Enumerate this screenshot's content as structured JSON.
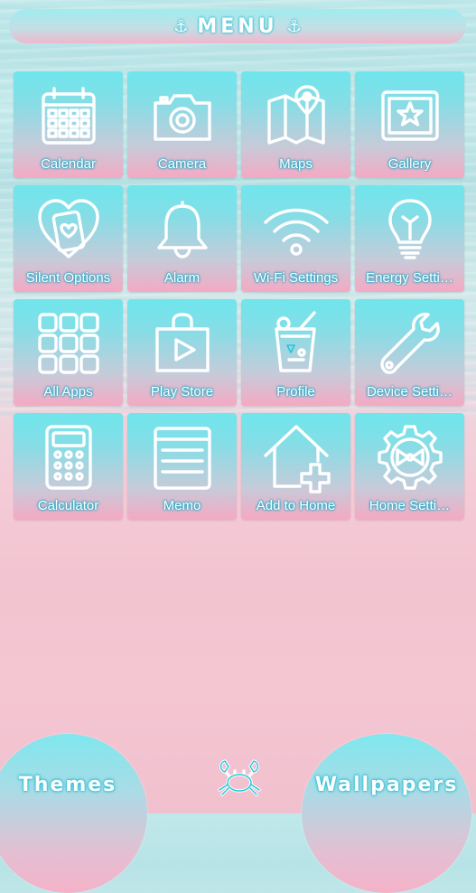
{
  "header": {
    "title": "MENU",
    "left_icon": "anchor-icon",
    "right_icon": "anchor-icon"
  },
  "apps": [
    {
      "label": "Calendar",
      "icon": "calendar-icon"
    },
    {
      "label": "Camera",
      "icon": "camera-icon"
    },
    {
      "label": "Maps",
      "icon": "map-icon"
    },
    {
      "label": "Gallery",
      "icon": "gallery-icon"
    },
    {
      "label": "Silent Options",
      "icon": "phone-heart-icon"
    },
    {
      "label": "Alarm",
      "icon": "bell-icon"
    },
    {
      "label": "Wi-Fi Settings",
      "icon": "wifi-icon"
    },
    {
      "label": "Energy Setti…",
      "icon": "lightbulb-icon"
    },
    {
      "label": "All Apps",
      "icon": "grid-icon"
    },
    {
      "label": "Play Store",
      "icon": "shopping-bag-play-icon"
    },
    {
      "label": "Profile",
      "icon": "drink-cup-icon"
    },
    {
      "label": "Device Setti…",
      "icon": "wrench-icon"
    },
    {
      "label": "Calculator",
      "icon": "calculator-icon"
    },
    {
      "label": "Memo",
      "icon": "memo-icon"
    },
    {
      "label": "Add to Home",
      "icon": "house-plus-icon"
    },
    {
      "label": "Home Setti…",
      "icon": "gear-bow-icon"
    }
  ],
  "footer": {
    "themes_label": "Themes",
    "wallpapers_label": "Wallpapers",
    "center_icon": "crab-icon"
  },
  "colors": {
    "accent": "#22c6dc",
    "pink": "#f5a9c3",
    "aqua": "#6fe6ec"
  }
}
